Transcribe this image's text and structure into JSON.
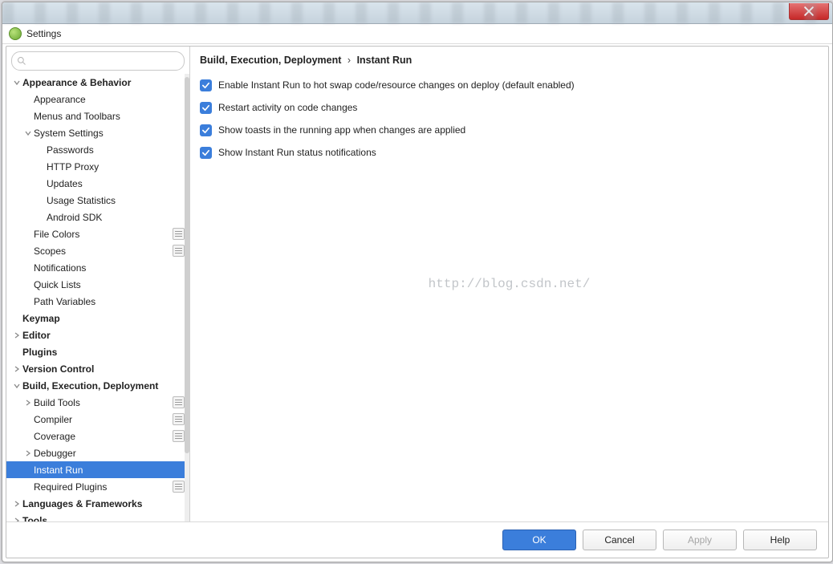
{
  "window": {
    "title": "Settings"
  },
  "search": {
    "placeholder": ""
  },
  "breadcrumb": {
    "parent": "Build, Execution, Deployment",
    "current": "Instant Run"
  },
  "options": {
    "enable_instant_run": "Enable Instant Run to hot swap code/resource changes on deploy (default enabled)",
    "restart_activity": "Restart activity on code changes",
    "show_toasts": "Show toasts in the running app when changes are applied",
    "show_status_notif": "Show Instant Run status notifications"
  },
  "watermark": "http://blog.csdn.net/",
  "buttons": {
    "ok": "OK",
    "cancel": "Cancel",
    "apply": "Apply",
    "help": "Help"
  },
  "tree": {
    "appearance_behavior": "Appearance & Behavior",
    "appearance": "Appearance",
    "menus_toolbars": "Menus and Toolbars",
    "system_settings": "System Settings",
    "passwords": "Passwords",
    "http_proxy": "HTTP Proxy",
    "updates": "Updates",
    "usage_statistics": "Usage Statistics",
    "android_sdk": "Android SDK",
    "file_colors": "File Colors",
    "scopes": "Scopes",
    "notifications": "Notifications",
    "quick_lists": "Quick Lists",
    "path_variables": "Path Variables",
    "keymap": "Keymap",
    "editor": "Editor",
    "plugins": "Plugins",
    "version_control": "Version Control",
    "build_exec_deploy": "Build, Execution, Deployment",
    "build_tools": "Build Tools",
    "compiler": "Compiler",
    "coverage": "Coverage",
    "debugger": "Debugger",
    "instant_run": "Instant Run",
    "required_plugins": "Required Plugins",
    "languages_frameworks": "Languages & Frameworks",
    "tools": "Tools"
  }
}
